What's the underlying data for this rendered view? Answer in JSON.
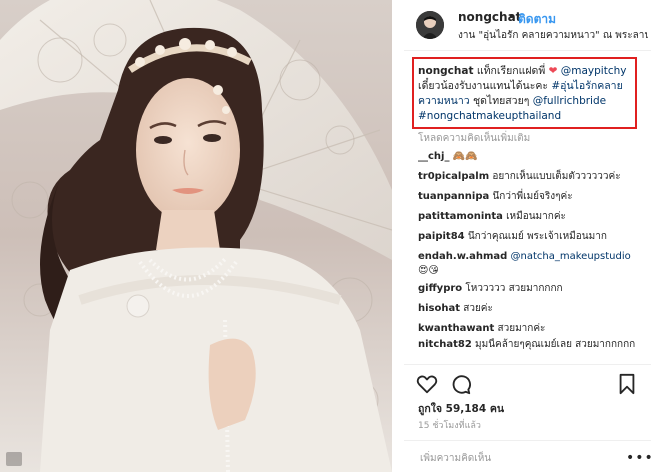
{
  "post": {
    "username": "nongchat",
    "separator": "•",
    "follow_label": "ติดตาม",
    "location": "งาน \"อุ่นไอรัก คลายความหนาว\" ณ พระลาน..."
  },
  "caption": {
    "username": "nongchat",
    "text_before_heart": " แท็กเรียกแฝดพี่ ",
    "heart": "❤",
    "mention_1": "@maypitchy",
    "text_mid": " เดี๋ยวน้องรับงานแทนได้นะคะ ",
    "hashtag_1": "#อุ่นไอรักคลายความหนาว",
    "text_dress": " ชุดไทยสวยๆ ",
    "mention_2": "@fullrichbride",
    "hashtag_2": "#nongchatmakeupthailand"
  },
  "load_more_label": "โหลดความคิดเห็นเพิ่มเติม",
  "comments": [
    {
      "user": "__chj_",
      "text": "🙈🙈"
    },
    {
      "user": "tr0picalpalm",
      "text": "อยากเห็นแบบเต็มตัววววววค่ะ"
    },
    {
      "user": "tuanpannipa",
      "text": "นึกว่าพี่เมย์จริงๆค่ะ"
    },
    {
      "user": "patittamoninta",
      "text": "เหมือนมากค่ะ"
    },
    {
      "user": "paipit84",
      "text": "นึกว่าคุณเมย์ พระเจ้าเหมือนมาก"
    },
    {
      "user": "endah.w.ahmad",
      "mention": "@natcha_makeupstudio",
      "text": "😍😘"
    },
    {
      "user": "giffypro",
      "text": "โหววววว สวยมากกกก"
    },
    {
      "user": "hisohat",
      "text": "สวยค่ะ"
    },
    {
      "user": "kwanthawant",
      "text": "สวยมากค่ะ"
    },
    {
      "user": "nitchat82",
      "text": "มุมนี้คล้ายๆคุณเมย์เลย สวยมากกกกก"
    }
  ],
  "likes_label": "ถูกใจ 59,184 คน",
  "time_label": "15 ชั่วโมงที่แล้ว",
  "comment_placeholder": "เพิ่มความคิดเห็น",
  "more_label": "•••",
  "icons": {
    "like": "heart-icon",
    "comment": "comment-bubble-icon",
    "save": "bookmark-icon"
  },
  "colors": {
    "link": "#003569",
    "follow": "#3897f0",
    "highlight_box": "#e02020",
    "heart": "#ed4956"
  }
}
